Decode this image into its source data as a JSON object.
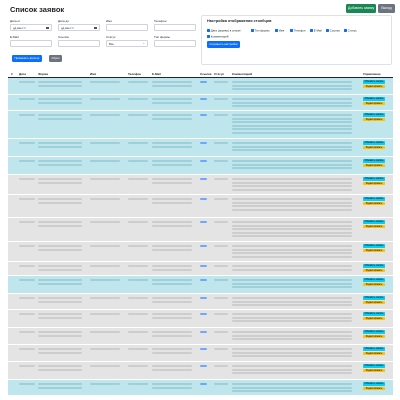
{
  "header": {
    "title": "Список заявок",
    "add_button": "Добавить заявку",
    "logout_button": "Выход"
  },
  "filters": {
    "date_from_label": "Дата от",
    "date_from_value": "дд.мм.гггг",
    "date_to_label": "Дата до",
    "date_to_value": "дд.мм.гггг",
    "name_label": "Имя",
    "phone_label": "Телефон",
    "email_label": "E-Mail",
    "sites_label": "Ссылка",
    "status_label": "Статус",
    "status_value": "Все",
    "form_type_label": "Тип формы",
    "apply_button": "Применить фильтр",
    "reset_button": "Сброс"
  },
  "columns_panel": {
    "title": "Настройка отображения столбцов",
    "options": [
      "Дата (дерево) в списке",
      "Тип формы",
      "Имя",
      "Телефон",
      "E-Mail",
      "Ссылка",
      "Статус",
      "Комментарий"
    ],
    "save_button": "Сохранить настройки"
  },
  "table": {
    "headers": [
      "#",
      "Дата",
      "Форма",
      "Имя",
      "Телефон",
      "E-Mail",
      "Ссылка",
      "Статус",
      "Комментарий",
      "Управление"
    ],
    "action_note": "Обновить запись",
    "action_edit": "Редактировать",
    "rows": [
      {
        "color": "#bfe6ec"
      },
      {
        "color": "#bfe6ec"
      },
      {
        "color": "#bfe6ec"
      },
      {
        "color": "#bfe6ec"
      },
      {
        "color": "#bfe6ec"
      },
      {
        "color": "#e4e4e4"
      },
      {
        "color": "#e4e4e4"
      },
      {
        "color": "#e4e4e4"
      },
      {
        "color": "#e4e4e4"
      },
      {
        "color": "#e4e4e4"
      },
      {
        "color": "#bfe6ec"
      },
      {
        "color": "#e4e4e4"
      },
      {
        "color": "#e4e4e4"
      },
      {
        "color": "#e4e4e4"
      },
      {
        "color": "#e4e4e4"
      },
      {
        "color": "#e4e4e4"
      },
      {
        "color": "#bfe6ec"
      },
      {
        "color": "#f4d7dc"
      }
    ]
  }
}
